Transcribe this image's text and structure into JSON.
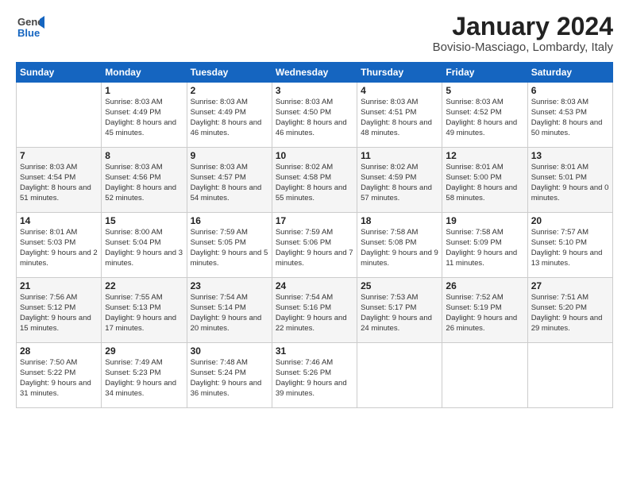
{
  "header": {
    "logo_general": "General",
    "logo_blue": "Blue",
    "title": "January 2024",
    "location": "Bovisio-Masciago, Lombardy, Italy"
  },
  "days": [
    "Sunday",
    "Monday",
    "Tuesday",
    "Wednesday",
    "Thursday",
    "Friday",
    "Saturday"
  ],
  "weeks": [
    [
      {
        "date": "",
        "sunrise": "",
        "sunset": "",
        "daylight": ""
      },
      {
        "date": "1",
        "sunrise": "Sunrise: 8:03 AM",
        "sunset": "Sunset: 4:49 PM",
        "daylight": "Daylight: 8 hours and 45 minutes."
      },
      {
        "date": "2",
        "sunrise": "Sunrise: 8:03 AM",
        "sunset": "Sunset: 4:49 PM",
        "daylight": "Daylight: 8 hours and 46 minutes."
      },
      {
        "date": "3",
        "sunrise": "Sunrise: 8:03 AM",
        "sunset": "Sunset: 4:50 PM",
        "daylight": "Daylight: 8 hours and 46 minutes."
      },
      {
        "date": "4",
        "sunrise": "Sunrise: 8:03 AM",
        "sunset": "Sunset: 4:51 PM",
        "daylight": "Daylight: 8 hours and 48 minutes."
      },
      {
        "date": "5",
        "sunrise": "Sunrise: 8:03 AM",
        "sunset": "Sunset: 4:52 PM",
        "daylight": "Daylight: 8 hours and 49 minutes."
      },
      {
        "date": "6",
        "sunrise": "Sunrise: 8:03 AM",
        "sunset": "Sunset: 4:53 PM",
        "daylight": "Daylight: 8 hours and 50 minutes."
      }
    ],
    [
      {
        "date": "7",
        "sunrise": "Sunrise: 8:03 AM",
        "sunset": "Sunset: 4:54 PM",
        "daylight": "Daylight: 8 hours and 51 minutes."
      },
      {
        "date": "8",
        "sunrise": "Sunrise: 8:03 AM",
        "sunset": "Sunset: 4:56 PM",
        "daylight": "Daylight: 8 hours and 52 minutes."
      },
      {
        "date": "9",
        "sunrise": "Sunrise: 8:03 AM",
        "sunset": "Sunset: 4:57 PM",
        "daylight": "Daylight: 8 hours and 54 minutes."
      },
      {
        "date": "10",
        "sunrise": "Sunrise: 8:02 AM",
        "sunset": "Sunset: 4:58 PM",
        "daylight": "Daylight: 8 hours and 55 minutes."
      },
      {
        "date": "11",
        "sunrise": "Sunrise: 8:02 AM",
        "sunset": "Sunset: 4:59 PM",
        "daylight": "Daylight: 8 hours and 57 minutes."
      },
      {
        "date": "12",
        "sunrise": "Sunrise: 8:01 AM",
        "sunset": "Sunset: 5:00 PM",
        "daylight": "Daylight: 8 hours and 58 minutes."
      },
      {
        "date": "13",
        "sunrise": "Sunrise: 8:01 AM",
        "sunset": "Sunset: 5:01 PM",
        "daylight": "Daylight: 9 hours and 0 minutes."
      }
    ],
    [
      {
        "date": "14",
        "sunrise": "Sunrise: 8:01 AM",
        "sunset": "Sunset: 5:03 PM",
        "daylight": "Daylight: 9 hours and 2 minutes."
      },
      {
        "date": "15",
        "sunrise": "Sunrise: 8:00 AM",
        "sunset": "Sunset: 5:04 PM",
        "daylight": "Daylight: 9 hours and 3 minutes."
      },
      {
        "date": "16",
        "sunrise": "Sunrise: 7:59 AM",
        "sunset": "Sunset: 5:05 PM",
        "daylight": "Daylight: 9 hours and 5 minutes."
      },
      {
        "date": "17",
        "sunrise": "Sunrise: 7:59 AM",
        "sunset": "Sunset: 5:06 PM",
        "daylight": "Daylight: 9 hours and 7 minutes."
      },
      {
        "date": "18",
        "sunrise": "Sunrise: 7:58 AM",
        "sunset": "Sunset: 5:08 PM",
        "daylight": "Daylight: 9 hours and 9 minutes."
      },
      {
        "date": "19",
        "sunrise": "Sunrise: 7:58 AM",
        "sunset": "Sunset: 5:09 PM",
        "daylight": "Daylight: 9 hours and 11 minutes."
      },
      {
        "date": "20",
        "sunrise": "Sunrise: 7:57 AM",
        "sunset": "Sunset: 5:10 PM",
        "daylight": "Daylight: 9 hours and 13 minutes."
      }
    ],
    [
      {
        "date": "21",
        "sunrise": "Sunrise: 7:56 AM",
        "sunset": "Sunset: 5:12 PM",
        "daylight": "Daylight: 9 hours and 15 minutes."
      },
      {
        "date": "22",
        "sunrise": "Sunrise: 7:55 AM",
        "sunset": "Sunset: 5:13 PM",
        "daylight": "Daylight: 9 hours and 17 minutes."
      },
      {
        "date": "23",
        "sunrise": "Sunrise: 7:54 AM",
        "sunset": "Sunset: 5:14 PM",
        "daylight": "Daylight: 9 hours and 20 minutes."
      },
      {
        "date": "24",
        "sunrise": "Sunrise: 7:54 AM",
        "sunset": "Sunset: 5:16 PM",
        "daylight": "Daylight: 9 hours and 22 minutes."
      },
      {
        "date": "25",
        "sunrise": "Sunrise: 7:53 AM",
        "sunset": "Sunset: 5:17 PM",
        "daylight": "Daylight: 9 hours and 24 minutes."
      },
      {
        "date": "26",
        "sunrise": "Sunrise: 7:52 AM",
        "sunset": "Sunset: 5:19 PM",
        "daylight": "Daylight: 9 hours and 26 minutes."
      },
      {
        "date": "27",
        "sunrise": "Sunrise: 7:51 AM",
        "sunset": "Sunset: 5:20 PM",
        "daylight": "Daylight: 9 hours and 29 minutes."
      }
    ],
    [
      {
        "date": "28",
        "sunrise": "Sunrise: 7:50 AM",
        "sunset": "Sunset: 5:22 PM",
        "daylight": "Daylight: 9 hours and 31 minutes."
      },
      {
        "date": "29",
        "sunrise": "Sunrise: 7:49 AM",
        "sunset": "Sunset: 5:23 PM",
        "daylight": "Daylight: 9 hours and 34 minutes."
      },
      {
        "date": "30",
        "sunrise": "Sunrise: 7:48 AM",
        "sunset": "Sunset: 5:24 PM",
        "daylight": "Daylight: 9 hours and 36 minutes."
      },
      {
        "date": "31",
        "sunrise": "Sunrise: 7:46 AM",
        "sunset": "Sunset: 5:26 PM",
        "daylight": "Daylight: 9 hours and 39 minutes."
      },
      {
        "date": "",
        "sunrise": "",
        "sunset": "",
        "daylight": ""
      },
      {
        "date": "",
        "sunrise": "",
        "sunset": "",
        "daylight": ""
      },
      {
        "date": "",
        "sunrise": "",
        "sunset": "",
        "daylight": ""
      }
    ]
  ]
}
